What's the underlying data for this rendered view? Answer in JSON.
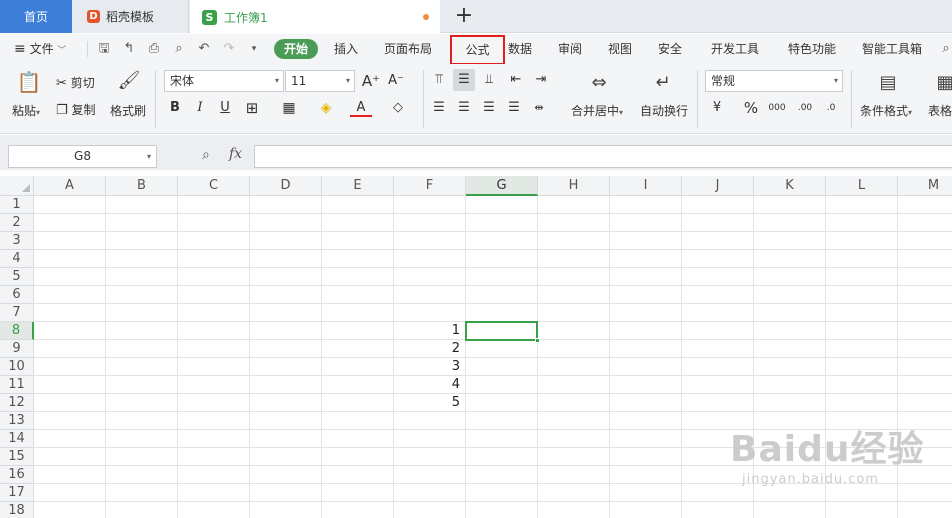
{
  "tabs": {
    "home": "首页",
    "docer": "稻壳模板",
    "workbook": "工作簿1",
    "new_tab": "+"
  },
  "menu": {
    "file": "文件",
    "start": "开始",
    "insert": "插入",
    "page_layout": "页面布局",
    "formula": "公式",
    "data": "数据",
    "review": "审阅",
    "view": "视图",
    "security": "安全",
    "dev_tools": "开发工具",
    "features": "特色功能",
    "smart_toolbox": "智能工具箱"
  },
  "ribbon": {
    "paste": "粘贴",
    "cut": "剪切",
    "copy": "复制",
    "format_painter": "格式刷",
    "font_name": "宋体",
    "font_size": "11",
    "merge_center": "合并居中",
    "wrap_text": "自动换行",
    "number_format": "常规",
    "conditional_format": "条件格式",
    "table_style": "表格"
  },
  "formula_bar": {
    "name_box": "G8",
    "fx": "fx"
  },
  "grid": {
    "columns": [
      "A",
      "B",
      "C",
      "D",
      "E",
      "F",
      "G",
      "H",
      "I",
      "J",
      "K",
      "L",
      "M"
    ],
    "selected_column": "G",
    "rows": [
      "1",
      "2",
      "3",
      "4",
      "5",
      "6",
      "7",
      "8",
      "9",
      "10",
      "11",
      "12",
      "13",
      "14",
      "15",
      "16",
      "17",
      "18"
    ],
    "selected_row": "8",
    "cells_F": [
      {
        "row": "8",
        "value": "1"
      },
      {
        "row": "9",
        "value": "2"
      },
      {
        "row": "10",
        "value": "3"
      },
      {
        "row": "11",
        "value": "4"
      },
      {
        "row": "12",
        "value": "5"
      }
    ]
  },
  "watermark": {
    "main": "Baidu经验",
    "sub": "jingyan.baidu.com"
  },
  "colors": {
    "home_tab": "#3d7ed8",
    "accent_green": "#3aa04a",
    "highlight_red": "#e02020"
  }
}
